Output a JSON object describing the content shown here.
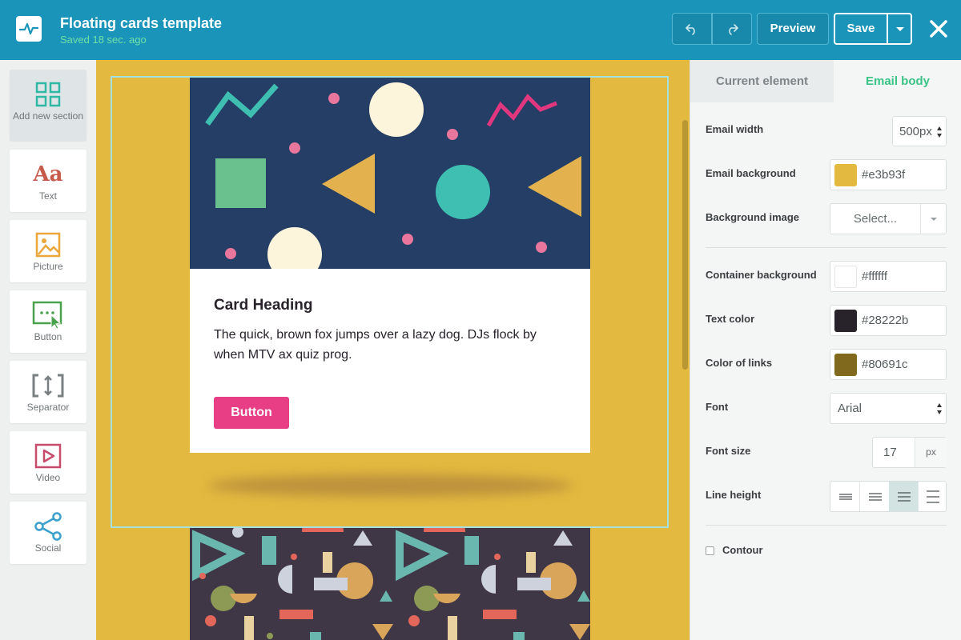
{
  "header": {
    "title": "Floating cards template",
    "saved_status": "Saved 18 sec. ago",
    "preview_label": "Preview",
    "save_label": "Save"
  },
  "sidebar": {
    "items": [
      {
        "label": "Add new section",
        "icon": "grid-icon"
      },
      {
        "label": "Text",
        "icon": "text-icon",
        "glyph": "Aa"
      },
      {
        "label": "Picture",
        "icon": "picture-icon"
      },
      {
        "label": "Button",
        "icon": "button-cursor-icon"
      },
      {
        "label": "Separator",
        "icon": "separator-icon"
      },
      {
        "label": "Video",
        "icon": "video-icon"
      },
      {
        "label": "Social",
        "icon": "share-icon"
      }
    ]
  },
  "card": {
    "heading": "Card Heading",
    "text": "The quick, brown fox jumps over a lazy dog. DJs flock by when MTV ax quiz prog.",
    "button_label": "Button"
  },
  "panel": {
    "tabs": [
      {
        "label": "Current element"
      },
      {
        "label": "Email body",
        "active": true
      }
    ],
    "email_width": {
      "label": "Email width",
      "value": "500px"
    },
    "email_background": {
      "label": "Email background",
      "value": "#e3b93f",
      "color": "#e3b93f"
    },
    "background_image": {
      "label": "Background image",
      "value": "Select..."
    },
    "container_background": {
      "label": "Container background",
      "value": "#ffffff",
      "color": "#ffffff"
    },
    "text_color": {
      "label": "Text color",
      "value": "#28222b",
      "color": "#28222b"
    },
    "link_color": {
      "label": "Color of links",
      "value": "#80691c",
      "color": "#80691c"
    },
    "font": {
      "label": "Font",
      "value": "Arial"
    },
    "font_size": {
      "label": "Font size",
      "value": "17",
      "unit": "px"
    },
    "line_height": {
      "label": "Line height",
      "options": 4,
      "selected_index": 2
    },
    "contour": {
      "label": "Contour",
      "checked": false
    }
  },
  "colors": {
    "header": "#1a95b9",
    "accent_green": "#3ac486",
    "canvas": "#e3b93f",
    "card_button": "#e83e85"
  }
}
